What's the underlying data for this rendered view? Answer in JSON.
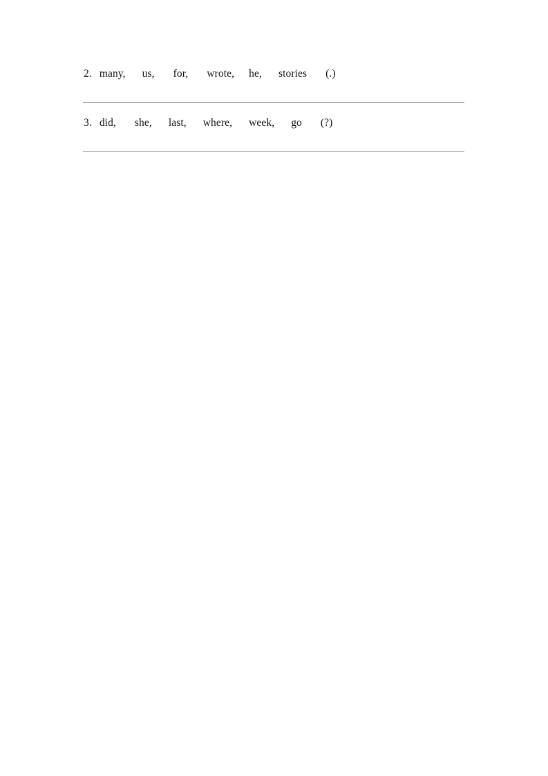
{
  "document": {
    "type": "worksheet",
    "page_background": "#ffffff",
    "text_color": "#141414",
    "rule_color": "#8a8a8a"
  },
  "exercises": [
    {
      "number": "2.",
      "words": [
        "many,",
        "us,",
        "for,",
        "wrote,",
        "he,",
        "stories"
      ],
      "punctuation_hint": "(.)",
      "full_line": "2. many,    us,    for,    wrote,    he,    stories    (.)",
      "answer_rule": true
    },
    {
      "number": "3.",
      "words": [
        "did,",
        "she,",
        "last,",
        "where,",
        "week,",
        "go"
      ],
      "punctuation_hint": "(?)",
      "full_line": "3. did,    she,    last,    where,    week,    go    (?)",
      "answer_rule": true
    }
  ]
}
